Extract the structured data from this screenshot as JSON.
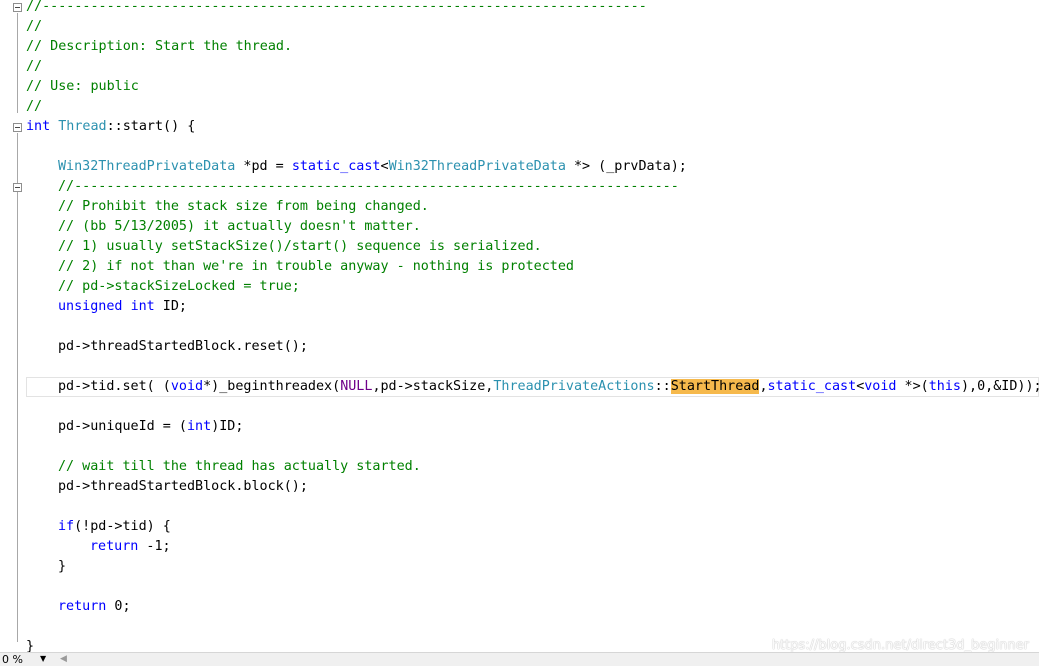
{
  "code": {
    "l1": "//---------------------------------------------------------------------------",
    "l2": "//",
    "l3": "// Description: Start the thread.",
    "l4": "//",
    "l5": "// Use: public",
    "l6": "//",
    "l7": {
      "k1": "int",
      "t1": "Thread",
      "rest": "::start() {"
    },
    "l9": {
      "t1": "Win32ThreadPrivateData",
      "a": " *pd = ",
      "k1": "static_cast",
      "b": "<",
      "t2": "Win32ThreadPrivateData",
      "c": " *> (_prvData);"
    },
    "l10": "//---------------------------------------------------------------------------",
    "l11": "// Prohibit the stack size from being changed.",
    "l12": "// (bb 5/13/2005) it actually doesn't matter.",
    "l13": "// 1) usually setStackSize()/start() sequence is serialized.",
    "l14": "// 2) if not than we're in trouble anyway - nothing is protected",
    "l15": "// pd->stackSizeLocked = true;",
    "l16": {
      "k1": "unsigned",
      "s1": " ",
      "k2": "int",
      "rest": " ID;"
    },
    "l18": "pd->threadStartedBlock.reset();",
    "l20": {
      "a": "pd->tid.set( (",
      "k1": "void",
      "b": "*)_beginthreadex(",
      "p1": "NULL",
      "c": ",pd->stackSize,",
      "t1": "ThreadPrivateActions",
      "d": "::",
      "hl": "StartThread",
      "e": ",",
      "k2": "static_cast",
      "f": "<",
      "k3": "void",
      "g": " *>(",
      "k4": "this",
      "h": "),0,&ID));"
    },
    "l22": {
      "a": "pd->uniqueId = (",
      "k1": "int",
      "b": ")ID;"
    },
    "l24": "// wait till the thread has actually started.",
    "l25": "pd->threadStartedBlock.block();",
    "l27": {
      "k1": "if",
      "rest": "(!pd->tid) {"
    },
    "l28": {
      "k1": "return",
      "rest": " -1;"
    },
    "l29": "}",
    "l31": {
      "k1": "return",
      "rest": " 0;"
    },
    "l33": "}"
  },
  "statusbar": {
    "zoom": "0 %"
  },
  "watermark": "https://blog.csdn.net/direct3d_beginner",
  "colors": {
    "comment": "#008000",
    "keyword": "#0000ff",
    "type": "#2b91af",
    "macro": "#6f008a",
    "highlight": "#f6b94c"
  }
}
